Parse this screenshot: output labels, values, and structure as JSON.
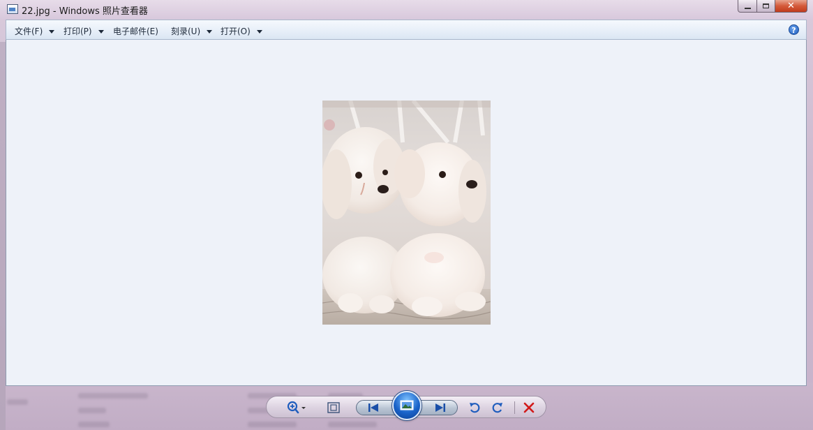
{
  "window": {
    "title": "22.jpg - Windows 照片查看器",
    "icon": "photo-viewer-icon"
  },
  "menu": {
    "items": [
      {
        "label": "文件(F)",
        "has_dropdown": true
      },
      {
        "label": "打印(P)",
        "has_dropdown": true
      },
      {
        "label": "电子邮件(E)",
        "has_dropdown": false
      },
      {
        "label": "刻录(U)",
        "has_dropdown": true
      },
      {
        "label": "打开(O)",
        "has_dropdown": true
      }
    ],
    "help_label": "?"
  },
  "controls": [
    "zoom-icon",
    "actual-size-icon",
    "previous-icon",
    "slideshow-icon",
    "next-icon",
    "rotate-counterclockwise-icon",
    "rotate-clockwise-icon",
    "delete-icon"
  ],
  "colors": {
    "viewer_bg": "#eef2f9",
    "frame": "#cdbad0",
    "accent_blue": "#1f5dbd",
    "delete_red": "#d11a1a"
  }
}
